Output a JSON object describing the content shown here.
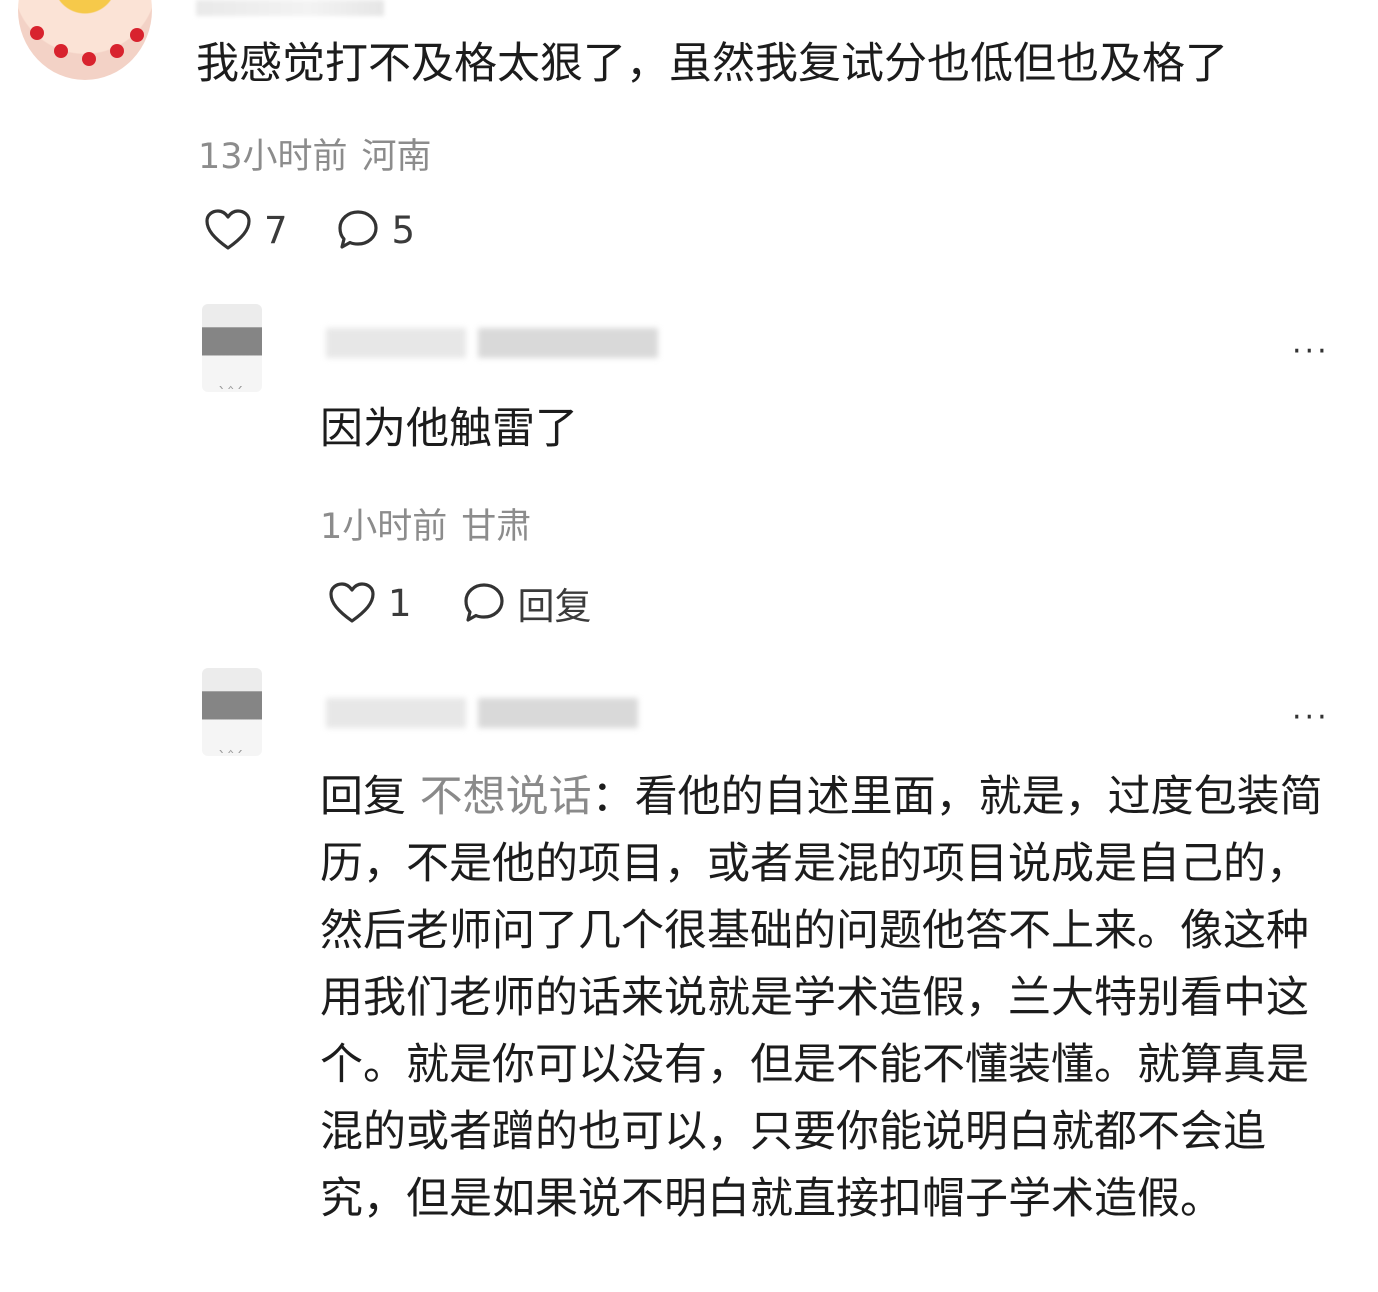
{
  "top_comment": {
    "text": "我感觉打不及格太狠了，虽然我复试分也低但也及格了",
    "time": "13小时前",
    "location": "河南",
    "likes": "7",
    "comments": "5"
  },
  "reply1": {
    "text": "因为他触雷了",
    "time": "1小时前",
    "location": "甘肃",
    "likes": "1",
    "reply_label": "回复",
    "more": "···"
  },
  "reply2": {
    "reply_prefix": "回复",
    "reply_to": "不想说话",
    "text": "：看他的自述里面，就是，过度包装简历，不是他的项目，或者是混的项目说成是自己的，然后老师问了几个很基础的问题他答不上来。像这种用我们老师的话来说就是学术造假，兰大特别看中这个。就是你可以没有，但是不能不懂装懂。就算真是混的或者蹭的也可以，只要你能说明白就都不会追究，但是如果说不明白就直接扣帽子学术造假。",
    "more": "···"
  },
  "icons": {
    "like": "heart-outline-icon",
    "comment": "speech-bubble-icon",
    "more": "more-dots-icon"
  }
}
